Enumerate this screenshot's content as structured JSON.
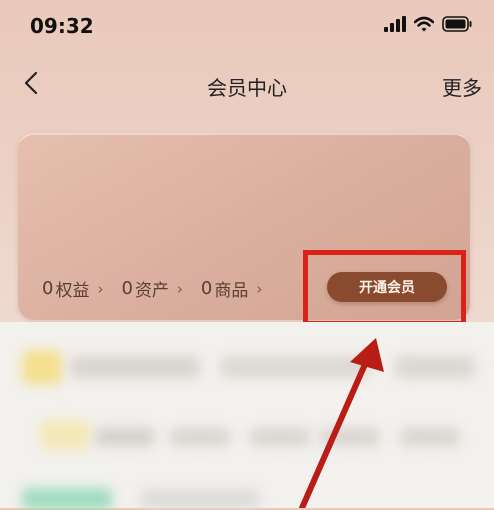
{
  "status_bar": {
    "time": "09:32"
  },
  "nav": {
    "title": "会员中心",
    "more_label": "更多"
  },
  "member_card": {
    "stats": [
      {
        "value": "0",
        "label": "权益"
      },
      {
        "value": "0",
        "label": "资产"
      },
      {
        "value": "0",
        "label": "商品"
      }
    ],
    "open_button_label": "开通会员"
  },
  "colors": {
    "button": "#8a4a2f",
    "highlight": "#d9231a",
    "annotation_arrow": "#b81d16"
  },
  "icons": [
    "signal-icon",
    "wifi-icon",
    "battery-icon",
    "back-arrow-icon",
    "chevron-right-icon"
  ]
}
